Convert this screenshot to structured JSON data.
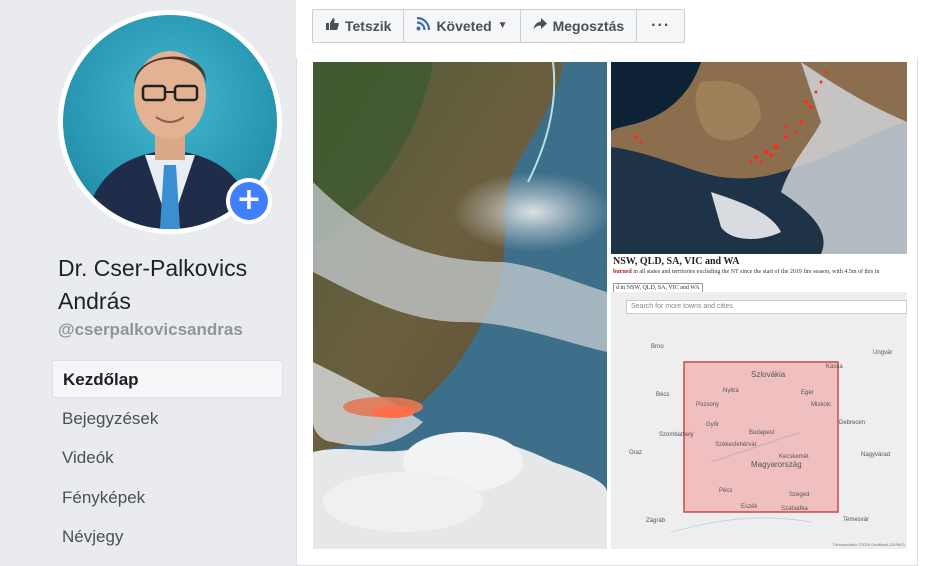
{
  "profile": {
    "name": "Dr. Cser-Palkovics András",
    "handle": "@cserpalkovicsandras",
    "add_icon": "plus-icon",
    "accent_color": "#4080ff"
  },
  "nav": {
    "items": [
      {
        "label": "Kezdőlap",
        "active": true
      },
      {
        "label": "Bejegyzések",
        "active": false
      },
      {
        "label": "Videók",
        "active": false
      },
      {
        "label": "Fényképek",
        "active": false
      },
      {
        "label": "Névjegy",
        "active": false
      }
    ]
  },
  "toolbar": {
    "like_label": "Tetszik",
    "like_icon": "thumbs-up-icon",
    "follow_label": "Követed",
    "follow_icon": "rss-icon",
    "share_label": "Megosztás",
    "share_icon": "share-arrow-icon",
    "more_label": "···"
  },
  "post": {
    "article_title": "NSW, QLD, SA, VIC and WA",
    "article_sub_bold": "burned",
    "article_sub": " in all states and territories excluding the NT since the start of the 2019 fire season, with 4.5m of this in",
    "article_select": "d in NSW, QLD, SA, VIC and WA",
    "map_search_placeholder": "Search for more towns and cities",
    "map_labels": {
      "szlovakia": "Szlovákia",
      "magyarorszag": "Magyarország",
      "budapest": "Budapest",
      "pozsony": "Pozsony",
      "brno": "Brno",
      "kassa": "Kassa",
      "graz": "Graz",
      "zagrab": "Zágráb",
      "temesvar": "Temesvár",
      "ungvar": "Ungvár",
      "nagyvarad": "Nagyvárad",
      "miskolc": "Miskolc",
      "gyor": "Győr",
      "szeged": "Szeged",
      "bees": "Bécs",
      "eszek": "Eszék",
      "szabadka": "Szabadka",
      "debrecen": "Debrecen",
      "kecskemet": "Kecskemét",
      "pecs": "Pécs",
      "nyitra": "Nyitra",
      "eger": "Eger",
      "szekesfehervar": "Székesfehérvár",
      "szombathely": "Szombathely"
    },
    "map_footer": "Térképadatok ©2020 GeoBasis-DE/BKG"
  }
}
